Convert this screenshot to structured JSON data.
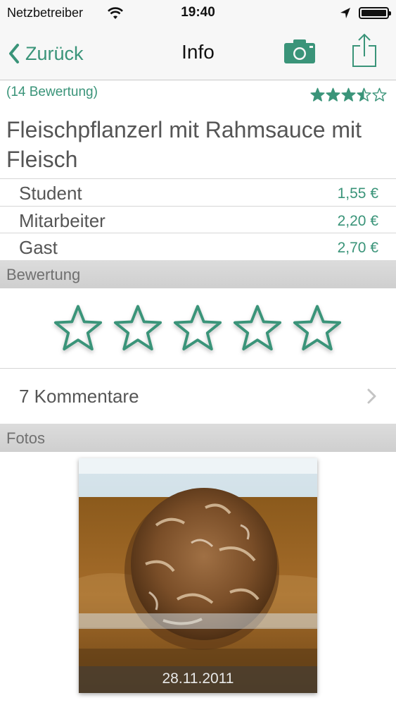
{
  "status": {
    "carrier": "Netzbetreiber",
    "time": "19:40",
    "battery_level": 1.0
  },
  "nav": {
    "back_label": "Zurück",
    "title": "Info"
  },
  "meal": {
    "rating_count_text": "(14 Bewertung)",
    "average_rating": 3.5,
    "average_rating_max": 5,
    "title": "Fleischpflanzerl mit Rahmsauce mit Fleisch"
  },
  "prices": [
    {
      "label": "Student",
      "value": "1,55 €"
    },
    {
      "label": "Mitarbeiter",
      "value": "2,20 €"
    },
    {
      "label": "Gast",
      "value": "2,70 €"
    }
  ],
  "rating_section": {
    "header": "Bewertung",
    "selected": 0,
    "max": 5
  },
  "comments": {
    "label": "7 Kommentare"
  },
  "photos_section": {
    "header": "Fotos",
    "photo_date": "28.11.2011"
  },
  "colors": {
    "accent": "#3a9479",
    "section_header": "#d4d4d4"
  },
  "icons": {
    "camera": "camera-icon",
    "share": "share-icon",
    "back": "chevron-left-icon",
    "disclosure": "chevron-right-icon",
    "wifi": "wifi-icon",
    "location": "location-arrow-icon"
  }
}
